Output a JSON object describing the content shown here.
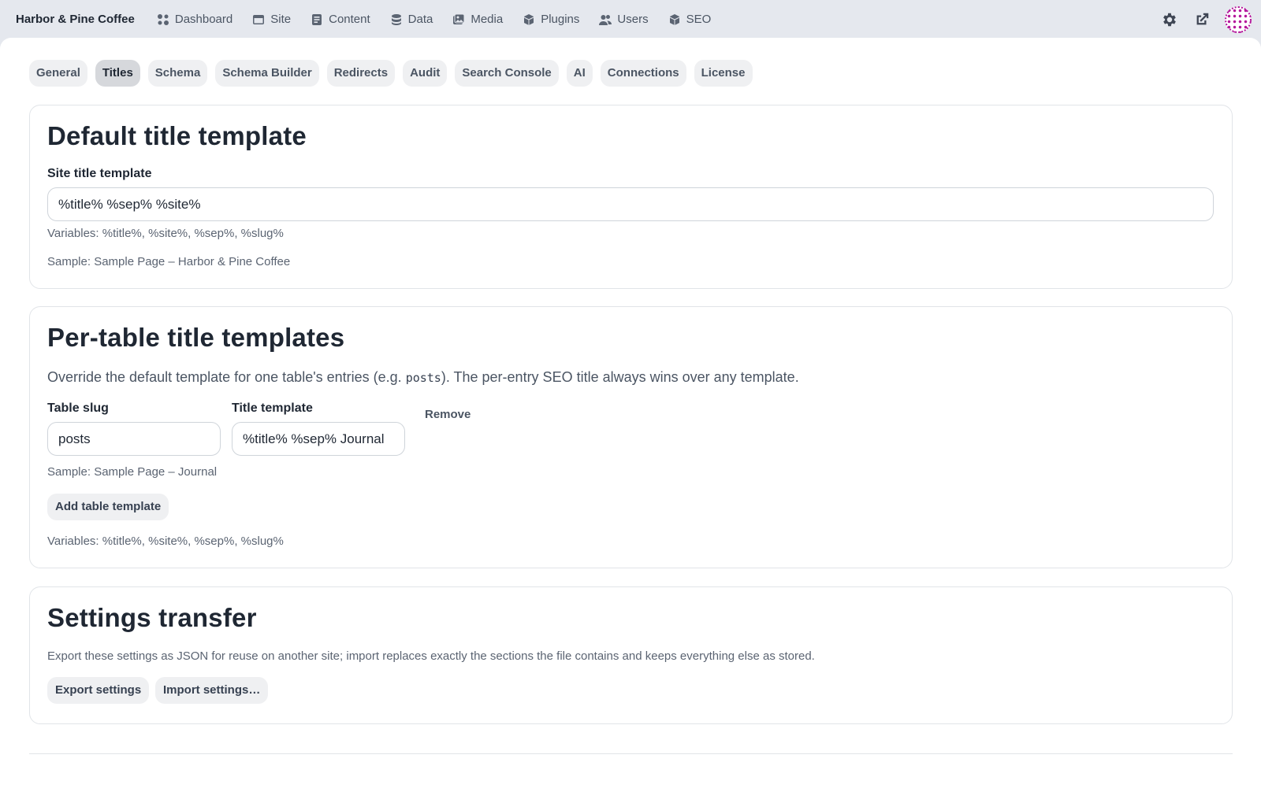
{
  "brand": "Harbor & Pine Coffee",
  "nav": {
    "dashboard": "Dashboard",
    "site": "Site",
    "content": "Content",
    "data": "Data",
    "media": "Media",
    "plugins": "Plugins",
    "users": "Users",
    "seo": "SEO"
  },
  "icons": {
    "settings": "gear-icon",
    "view_site": "external-link-icon",
    "avatar": "avatar"
  },
  "tabs": {
    "general": "General",
    "titles": "Titles",
    "schema": "Schema",
    "schema_builder": "Schema Builder",
    "redirects": "Redirects",
    "audit": "Audit",
    "search_console": "Search Console",
    "ai": "AI",
    "connections": "Connections",
    "license": "License",
    "active": "Titles"
  },
  "default_title": {
    "heading": "Default title template",
    "label": "Site title template",
    "value": "%title% %sep% %site%",
    "variables": "Variables: %title%, %site%, %sep%, %slug%",
    "sample": "Sample: Sample Page – Harbor & Pine Coffee"
  },
  "per_table": {
    "heading": "Per-table title templates",
    "desc_before": "Override the default template for one table's entries (e.g. ",
    "desc_code": "posts",
    "desc_after": "). The per-entry SEO title always wins over any template.",
    "slug_label": "Table slug",
    "template_label": "Title template",
    "slug_value": "posts",
    "template_value": "%title% %sep% Journal",
    "remove": "Remove",
    "sample": "Sample: Sample Page – Journal",
    "add_button": "Add table template",
    "variables": "Variables: %title%, %site%, %sep%, %slug%"
  },
  "transfer": {
    "heading": "Settings transfer",
    "desc": "Export these settings as JSON for reuse on another site; import replaces exactly the sections the file contains and keeps everything else as stored.",
    "export": "Export settings",
    "import": "Import settings…"
  },
  "colors": {
    "accent": "#b4169b",
    "background": "#e5e8ee",
    "panel": "#ffffff",
    "tab_active": "#d6d8dc"
  }
}
